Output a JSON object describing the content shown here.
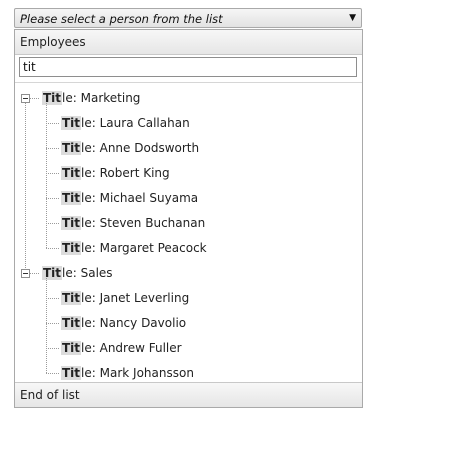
{
  "combo": {
    "placeholder_text": "Please select a person from the list",
    "arrow_icon": "dropdown-arrow-icon"
  },
  "header": {
    "label": "Employees"
  },
  "filter": {
    "value": "tit"
  },
  "tree": {
    "groups": [
      {
        "prefix": "Tit",
        "rest": "le: Marketing",
        "children": [
          {
            "prefix": "Tit",
            "rest": "le: Laura Callahan"
          },
          {
            "prefix": "Tit",
            "rest": "le: Anne Dodsworth"
          },
          {
            "prefix": "Tit",
            "rest": "le: Robert King"
          },
          {
            "prefix": "Tit",
            "rest": "le: Michael Suyama"
          },
          {
            "prefix": "Tit",
            "rest": "le: Steven Buchanan"
          },
          {
            "prefix": "Tit",
            "rest": "le: Margaret Peacock"
          }
        ]
      },
      {
        "prefix": "Tit",
        "rest": "le: Sales",
        "children": [
          {
            "prefix": "Tit",
            "rest": "le: Janet Leverling"
          },
          {
            "prefix": "Tit",
            "rest": "le: Nancy Davolio"
          },
          {
            "prefix": "Tit",
            "rest": "le: Andrew Fuller"
          },
          {
            "prefix": "Tit",
            "rest": "le: Mark Johansson"
          }
        ]
      }
    ]
  },
  "footer": {
    "label": "End of list"
  }
}
